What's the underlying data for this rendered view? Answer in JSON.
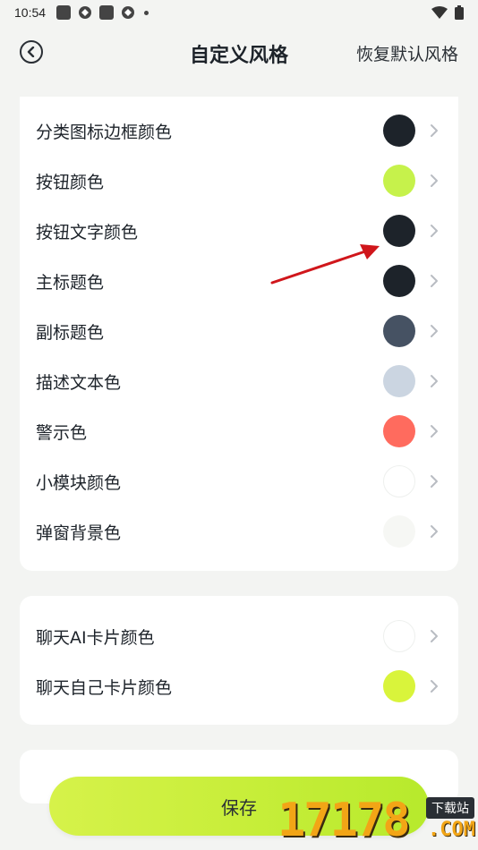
{
  "status_bar": {
    "time": "10:54"
  },
  "header": {
    "title": "自定义风格",
    "restore_label": "恢复默认风格"
  },
  "section1": {
    "items": [
      {
        "label": "分类图标边框颜色",
        "color": "#1d232a"
      },
      {
        "label": "按钮颜色",
        "color": "#c6f24b"
      },
      {
        "label": "按钮文字颜色",
        "color": "#1d232a"
      },
      {
        "label": "主标题色",
        "color": "#1d232a"
      },
      {
        "label": "副标题色",
        "color": "#465263"
      },
      {
        "label": "描述文本色",
        "color": "#cbd5e1"
      },
      {
        "label": "警示色",
        "color": "#ff6b5e"
      },
      {
        "label": "小模块颜色",
        "color": "#ffffff"
      },
      {
        "label": "弹窗背景色",
        "color": "#f6f7f4"
      }
    ]
  },
  "section2": {
    "items": [
      {
        "label": "聊天AI卡片颜色",
        "color": "#ffffff"
      },
      {
        "label": "聊天自己卡片颜色",
        "color": "#d9f43b"
      }
    ]
  },
  "save_button": {
    "label": "保存"
  },
  "watermark": {
    "number": "17178",
    "tag": "下载站",
    "domain": ".COM"
  }
}
